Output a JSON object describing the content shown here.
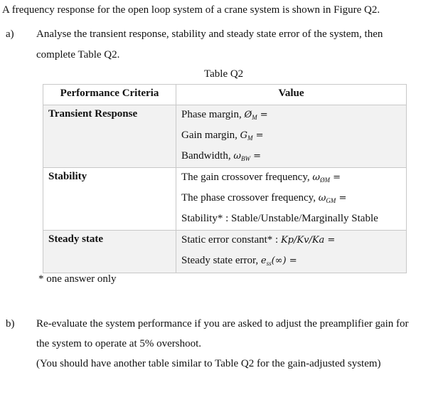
{
  "intro": "A frequency response for the open loop system of a crane system is shown in Figure Q2.",
  "part_a": {
    "label": "a)",
    "text_line1": "Analyse the transient response, stability and steady state error of the system, then",
    "text_line2": "complete Table Q2."
  },
  "table": {
    "caption": "Table Q2",
    "headers": [
      "Performance Criteria",
      "Value"
    ],
    "rows": [
      {
        "criteria": "Transient Response",
        "values": [
          {
            "text": "Phase margin, ",
            "sym": "Ø",
            "sub": "M",
            "suffix": " ="
          },
          {
            "text": "Gain margin, ",
            "sym": "G",
            "sub": "M",
            "suffix": " ="
          },
          {
            "text": "Bandwidth, ",
            "sym": "ω",
            "sub": "BW",
            "suffix": " ="
          }
        ]
      },
      {
        "criteria": "Stability",
        "values": [
          {
            "text": "The gain crossover frequency, ",
            "sym": "ω",
            "sub": "ØM",
            "suffix": " ="
          },
          {
            "text": "The phase crossover frequency, ",
            "sym": "ω",
            "sub": "GM",
            "suffix": " ="
          },
          {
            "text": "Stability* : Stable/Unstable/Marginally Stable"
          }
        ]
      },
      {
        "criteria": "Steady state",
        "values": [
          {
            "text": "Static error constant* : ",
            "math": "Kp/Kv/Ka",
            "suffix": " ="
          },
          {
            "text": "Steady state error, ",
            "sym": "e",
            "sub": "ss",
            "after": "(∞)",
            "suffix": " ="
          }
        ]
      }
    ],
    "footnote": "* one answer only"
  },
  "part_b": {
    "label": "b)",
    "text_line1": "Re-evaluate the system performance if you are asked to adjust the preamplifier gain for",
    "text_line2": "the system to operate at 5% overshoot.",
    "text_line3": "(You should have another table similar to Table Q2 for the gain-adjusted system)"
  }
}
